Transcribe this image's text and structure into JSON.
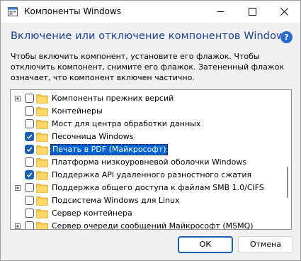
{
  "window": {
    "title": "Компоненты Windows"
  },
  "heading": "Включение или отключение компонентов Windows",
  "help_icon_glyph": "?",
  "description": "Чтобы включить компонент, установите его флажок. Чтобы отключить компонент, снимите его флажок. Затененный флажок означает, что компонент включен частично.",
  "features": [
    {
      "label": "Компоненты прежних версий",
      "checked": false,
      "expandable": true,
      "selected": false
    },
    {
      "label": "Контейнеры",
      "checked": false,
      "expandable": false,
      "selected": false
    },
    {
      "label": "Мост для центра обработки данных",
      "checked": false,
      "expandable": false,
      "selected": false
    },
    {
      "label": "Песочница Windows",
      "checked": true,
      "expandable": false,
      "selected": false
    },
    {
      "label": "Печать в PDF (Майкрософт)",
      "checked": true,
      "expandable": false,
      "selected": true
    },
    {
      "label": "Платформа низкоуровневой оболочки Windows",
      "checked": false,
      "expandable": false,
      "selected": false
    },
    {
      "label": "Поддержка API удаленного разностного сжатия",
      "checked": true,
      "expandable": false,
      "selected": false
    },
    {
      "label": "Поддержка общего доступа к файлам SMB 1.0/CIFS",
      "checked": false,
      "expandable": true,
      "selected": false
    },
    {
      "label": "Подсистема Windows для Linux",
      "checked": false,
      "expandable": false,
      "selected": false
    },
    {
      "label": "Сервер контейнера",
      "checked": false,
      "expandable": false,
      "selected": false
    },
    {
      "label": "Сервер очереди сообщений Майкрософт (MSMQ)",
      "checked": false,
      "expandable": true,
      "selected": false
    }
  ],
  "buttons": {
    "ok": "ОК",
    "cancel": "Отмена"
  },
  "colors": {
    "heading": "#1d3f91",
    "accent": "#1a5fb4",
    "selection": "#0063d1",
    "folder": "#f3c24b"
  },
  "icons": {
    "app": "windows-features-icon",
    "folder": "folder-icon",
    "expander": "plus-expander-icon",
    "help": "help-icon"
  }
}
